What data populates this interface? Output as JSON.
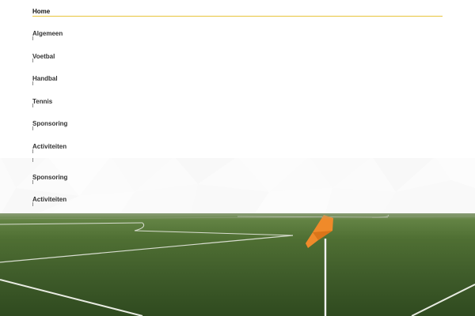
{
  "nav": {
    "home_label": "Home",
    "items": [
      {
        "label": "Algemeen"
      },
      {
        "label": "Voetbal"
      },
      {
        "label": "Handbal"
      },
      {
        "label": "Tennis"
      },
      {
        "label": "Sponsoring"
      },
      {
        "label": "Activiteiten"
      }
    ],
    "overlay_items": [
      {
        "label": "Sponsoring"
      },
      {
        "label": "Activiteiten"
      }
    ]
  },
  "colors": {
    "accent_underline": "#e8c53c",
    "corner_flag": "#f08a2a",
    "pitch_green": "#3f5c2a"
  },
  "hero": {
    "image": "football-pitch-corner-flag"
  }
}
